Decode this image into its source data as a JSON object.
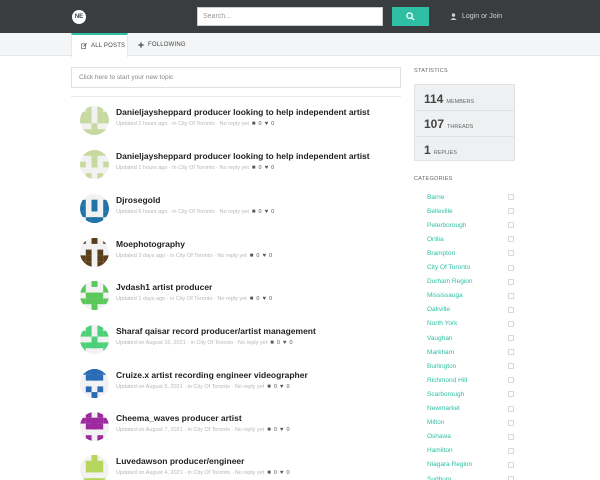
{
  "header": {
    "logo_text": "NE",
    "search_placeholder": "Search...",
    "login_label": "Login or Join"
  },
  "tabs": [
    {
      "label": "All Posts",
      "active": true
    },
    {
      "label": "Following",
      "active": false
    }
  ],
  "composer": {
    "placeholder": "Click here to start your new topic"
  },
  "topics": [
    {
      "title": "Danieljaysheppard producer looking to help independent artist",
      "meta": "Updated 1 hours ago · in City Of Toronto · No reply yet",
      "views": "0",
      "likes": "0",
      "color": "#c8d9a0"
    },
    {
      "title": "Danieljaysheppard producer looking to help independent artist",
      "meta": "Updated 1 hours ago · in City Of Toronto · No reply yet",
      "views": "0",
      "likes": "0",
      "color": "#c8d9a0"
    },
    {
      "title": "Djrosegold",
      "meta": "Updated 6 hours ago · in City Of Toronto · No reply yet",
      "views": "0",
      "likes": "0",
      "color": "#2274a8"
    },
    {
      "title": "Moephotography",
      "meta": "Updated 3 days ago · in City Of Toronto · No reply yet",
      "views": "0",
      "likes": "0",
      "color": "#5a3d1a"
    },
    {
      "title": "Jvdash1 artist producer",
      "meta": "Updated 1 days ago · in City Of Toronto · No reply yet",
      "views": "0",
      "likes": "0",
      "color": "#5cc85a"
    },
    {
      "title": "Sharaf qaisar record producer/artist management",
      "meta": "Updated on August 16, 2021 · in City Of Toronto · No reply yet",
      "views": "0",
      "likes": "0",
      "color": "#4cd07a"
    },
    {
      "title": "Cruize.x artist recording engineer videographer",
      "meta": "Updated on August 5, 2021 · in City Of Toronto · No reply yet",
      "views": "0",
      "likes": "0",
      "color": "#2a6bb5"
    },
    {
      "title": "Cheema_waves producer artist",
      "meta": "Updated on August 7, 2021 · in City Of Toronto · No reply yet",
      "views": "0",
      "likes": "0",
      "color": "#9c2a9e"
    },
    {
      "title": "Luvedawson producer/engineer",
      "meta": "Updated on August 4, 2021 · in City Of Toronto · No reply yet",
      "views": "0",
      "likes": "0",
      "color": "#b5d65a"
    }
  ],
  "sidebar": {
    "statistics_heading": "Statistics",
    "stats": [
      {
        "value": "114",
        "label": "Members"
      },
      {
        "value": "107",
        "label": "Threads"
      },
      {
        "value": "1",
        "label": "Replies"
      }
    ],
    "categories_heading": "Categories",
    "categories": [
      "Barrie",
      "Belleville",
      "Peterborough",
      "Orillia",
      "Brampton",
      "City Of Toronto",
      "Durham Region",
      "Mississauga",
      "Oakville",
      "North York",
      "Vaughan",
      "Markham",
      "Burlington",
      "Richmond Hill",
      "Scarborough",
      "Newmarket",
      "Milton",
      "Oshawa",
      "Hamilton",
      "Niagara Region",
      "Sudbury"
    ]
  },
  "colors": {
    "accent": "#2ebfa5",
    "topbar": "#3a3d40"
  }
}
